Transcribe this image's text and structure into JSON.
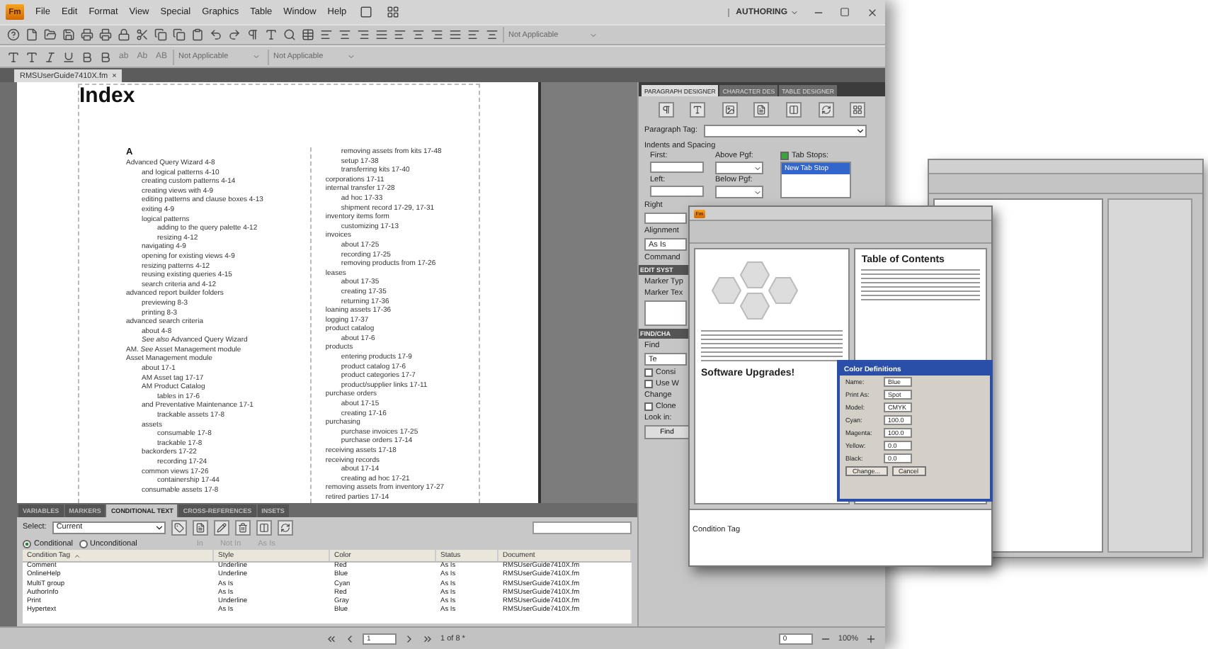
{
  "app": {
    "logo": "Fm",
    "menu": [
      "File",
      "Edit",
      "Format",
      "View",
      "Special",
      "Graphics",
      "Table",
      "Window",
      "Help"
    ],
    "workspace": "AUTHORING",
    "toolbar_dropdown": "Not Applicable"
  },
  "format_bar": {
    "case_buttons": [
      "ab",
      "Ab",
      "AB"
    ],
    "dropdowns": [
      "Not Applicable",
      "Not Applicable"
    ]
  },
  "document_tab": {
    "label": "RMSUserGuide7410X.fm",
    "close": "×"
  },
  "page": {
    "title": "Index",
    "letter": "A",
    "column_1": [
      {
        "text": "Advanced Query Wizard 4-8",
        "children": [
          {
            "text": "and logical patterns 4-10"
          },
          {
            "text": "creating custom patterns 4-14"
          },
          {
            "text": "creating views with 4-9"
          },
          {
            "text": "editing patterns and clause boxes 4-13"
          },
          {
            "text": "exiting 4-9"
          },
          {
            "text": "logical patterns",
            "children": [
              {
                "text": "adding to the query palette 4-12"
              },
              {
                "text": "resizing 4-12"
              }
            ]
          },
          {
            "text": "navigating 4-9"
          },
          {
            "text": "opening for existing views 4-9"
          },
          {
            "text": "resizing patterns 4-12"
          },
          {
            "text": "reusing existing queries 4-15"
          },
          {
            "text": "search criteria and 4-12"
          }
        ]
      },
      {
        "text": "advanced report builder folders",
        "children": [
          {
            "text": "previewing 8-3"
          },
          {
            "text": "printing 8-3"
          }
        ]
      },
      {
        "text": "advanced search criteria",
        "children": [
          {
            "text": "about 4-8"
          },
          {
            "text": "*See also* Advanced Query Wizard"
          }
        ]
      },
      {
        "text": "AM. *See* Asset Management module"
      },
      {
        "text": "Asset Management module",
        "children": [
          {
            "text": "about 17-1"
          },
          {
            "text": "AM Asset tag 17-17"
          },
          {
            "text": "AM Product Catalog",
            "children": [
              {
                "text": "tables in 17-6"
              }
            ]
          },
          {
            "text": "and Preventative Maintenance 17-1",
            "children": [
              {
                "text": "trackable assets 17-8"
              }
            ]
          },
          {
            "text": "assets",
            "children": [
              {
                "text": "consumable 17-8"
              },
              {
                "text": "trackable 17-8"
              }
            ]
          },
          {
            "text": "backorders 17-22",
            "children": [
              {
                "text": "recording 17-24"
              }
            ]
          },
          {
            "text": "common views 17-26",
            "children": [
              {
                "text": "containership 17-44"
              }
            ]
          },
          {
            "text": "consumable assets 17-8"
          }
        ]
      }
    ],
    "column_2": [
      {
        "children": [
          {
            "text": "removing assets from kits 17-48"
          },
          {
            "text": "setup 17-38"
          },
          {
            "text": "transferring kits 17-40"
          }
        ]
      },
      {
        "text": "corporations 17-11"
      },
      {
        "text": "internal transfer 17-28",
        "children": [
          {
            "text": "ad hoc 17-33"
          },
          {
            "text": "shipment record 17-29, 17-31"
          }
        ]
      },
      {
        "text": "inventory items form",
        "children": [
          {
            "text": "customizing 17-13"
          }
        ]
      },
      {
        "text": "invoices",
        "children": [
          {
            "text": "about 17-25"
          },
          {
            "text": "recording 17-25"
          },
          {
            "text": "removing products from 17-26"
          }
        ]
      },
      {
        "text": "leases",
        "children": [
          {
            "text": "about 17-35"
          },
          {
            "text": "creating 17-35"
          },
          {
            "text": "returning 17-36"
          }
        ]
      },
      {
        "text": "loaning assets 17-36"
      },
      {
        "text": "logging 17-37"
      },
      {
        "text": "product catalog",
        "children": [
          {
            "text": "about 17-6"
          }
        ]
      },
      {
        "text": "products",
        "children": [
          {
            "text": "entering products 17-9"
          },
          {
            "text": "product catalog 17-6"
          },
          {
            "text": "product categories 17-7"
          },
          {
            "text": "product/supplier links 17-11"
          }
        ]
      },
      {
        "text": "purchase orders",
        "children": [
          {
            "text": "about 17-15"
          },
          {
            "text": "creating 17-16"
          }
        ]
      },
      {
        "text": "purchasing",
        "children": [
          {
            "text": "purchase invoices 17-25"
          },
          {
            "text": "purchase orders 17-14"
          }
        ]
      },
      {
        "text": "receiving assets 17-18"
      },
      {
        "text": "receiving records",
        "children": [
          {
            "text": "about 17-14"
          },
          {
            "text": "creating ad hoc 17-21"
          }
        ]
      },
      {
        "text": "removing assets from inventory 17-27"
      },
      {
        "text": "retired parties 17-14"
      }
    ]
  },
  "paragraph_designer": {
    "tabs": [
      {
        "label": "PARAGRAPH DESIGNER",
        "selected": true
      },
      {
        "label": "CHARACTER DES",
        "selected": false
      },
      {
        "label": "TABLE DESIGNER",
        "selected": false
      }
    ],
    "tag_label": "Paragraph Tag:",
    "section": "Indents and Spacing",
    "first": "First:",
    "above": "Above Pgf:",
    "left": "Left:",
    "below": "Below Pgf:",
    "tab_stops": {
      "label": "Tab Stops:",
      "checked": true
    },
    "tab_stop_item": {
      "label": "New Tab Stop",
      "selected": true
    },
    "lower": [
      {
        "kind": "label",
        "text": "Right"
      },
      {
        "kind": "field"
      },
      {
        "kind": "label",
        "text": "Alignment"
      },
      {
        "kind": "value",
        "text": "As Is"
      },
      {
        "kind": "label",
        "text": "Command"
      },
      {
        "kind": "header",
        "text": "EDIT SYST"
      },
      {
        "kind": "label",
        "text": "Marker Typ"
      },
      {
        "kind": "label",
        "text": "Marker Tex"
      },
      {
        "kind": "area"
      },
      {
        "kind": "header",
        "text": "FIND/CHA"
      },
      {
        "kind": "label",
        "text": "Find"
      },
      {
        "kind": "value",
        "text": "Te"
      },
      {
        "kind": "check",
        "text": "Consi",
        "checked": false
      },
      {
        "kind": "check",
        "text": "Use W",
        "checked": false
      },
      {
        "kind": "label",
        "text": "Change"
      },
      {
        "kind": "check",
        "text": "Clone",
        "checked": false
      },
      {
        "kind": "label",
        "text": "Look in:"
      },
      {
        "kind": "button",
        "text": "Find"
      }
    ]
  },
  "bottom_panel": {
    "tabs": [
      {
        "label": "VARIABLES",
        "selected": false
      },
      {
        "label": "MARKERS",
        "selected": false
      },
      {
        "label": "CONDITIONAL TEXT",
        "selected": true
      },
      {
        "label": "CROSS-REFERENCES",
        "selected": false
      },
      {
        "label": "INSETS",
        "selected": false
      }
    ],
    "select_label": "Select:",
    "select_value": "Current",
    "radios": [
      {
        "label": "Conditional",
        "selected": true
      },
      {
        "label": "Unconditional",
        "selected": false
      }
    ],
    "status_buttons": [
      {
        "label": "In",
        "disabled": true
      },
      {
        "label": "Not In",
        "disabled": true
      },
      {
        "label": "As Is",
        "disabled": true
      }
    ],
    "columns": [
      {
        "label": "Condition Tag",
        "sorted": true
      },
      {
        "label": "Style",
        "sorted": false
      },
      {
        "label": "Color",
        "sorted": false
      },
      {
        "label": "Status",
        "sorted": false
      },
      {
        "label": "Document",
        "sorted": false
      }
    ],
    "rows": [
      [
        "Comment",
        "Underline",
        "Red",
        "As Is",
        "RMSUserGuide7410X.fm"
      ],
      [
        "OnlineHelp",
        "Underline",
        "Blue",
        "As Is",
        "RMSUserGuide7410X.fm"
      ],
      [
        "MultiT group",
        "As Is",
        "Cyan",
        "As Is",
        "RMSUserGuide7410X.fm"
      ],
      [
        "AuthorInfo",
        "As Is",
        "Red",
        "As Is",
        "RMSUserGuide7410X.fm"
      ],
      [
        "Print",
        "Underline",
        "Gray",
        "As Is",
        "RMSUserGuide7410X.fm"
      ],
      [
        "Hypertext",
        "As Is",
        "Blue",
        "As Is",
        "RMSUserGuide7410X.fm"
      ]
    ]
  },
  "status_bar": {
    "page": "1",
    "page_count": "1 of 8 *",
    "field": "0",
    "zoom": "100%"
  },
  "second_window": {
    "logo": "Fm",
    "toc_title": "Table of Contents",
    "heading": "Software Upgrades!",
    "dialog": {
      "title": "Color Definitions",
      "fields": [
        {
          "label": "Name:",
          "value": "Blue"
        },
        {
          "label": "Print As:",
          "value": "Spot"
        },
        {
          "label": "Model:",
          "value": "CMYK"
        },
        {
          "label": "Cyan:",
          "value": "100.0"
        },
        {
          "label": "Magenta:",
          "value": "100.0"
        },
        {
          "label": "Yellow:",
          "value": "0.0"
        },
        {
          "label": "Black:",
          "value": "0.0"
        }
      ],
      "buttons": [
        "Change...",
        "Cancel"
      ]
    },
    "table_header": "Condition Tag"
  }
}
